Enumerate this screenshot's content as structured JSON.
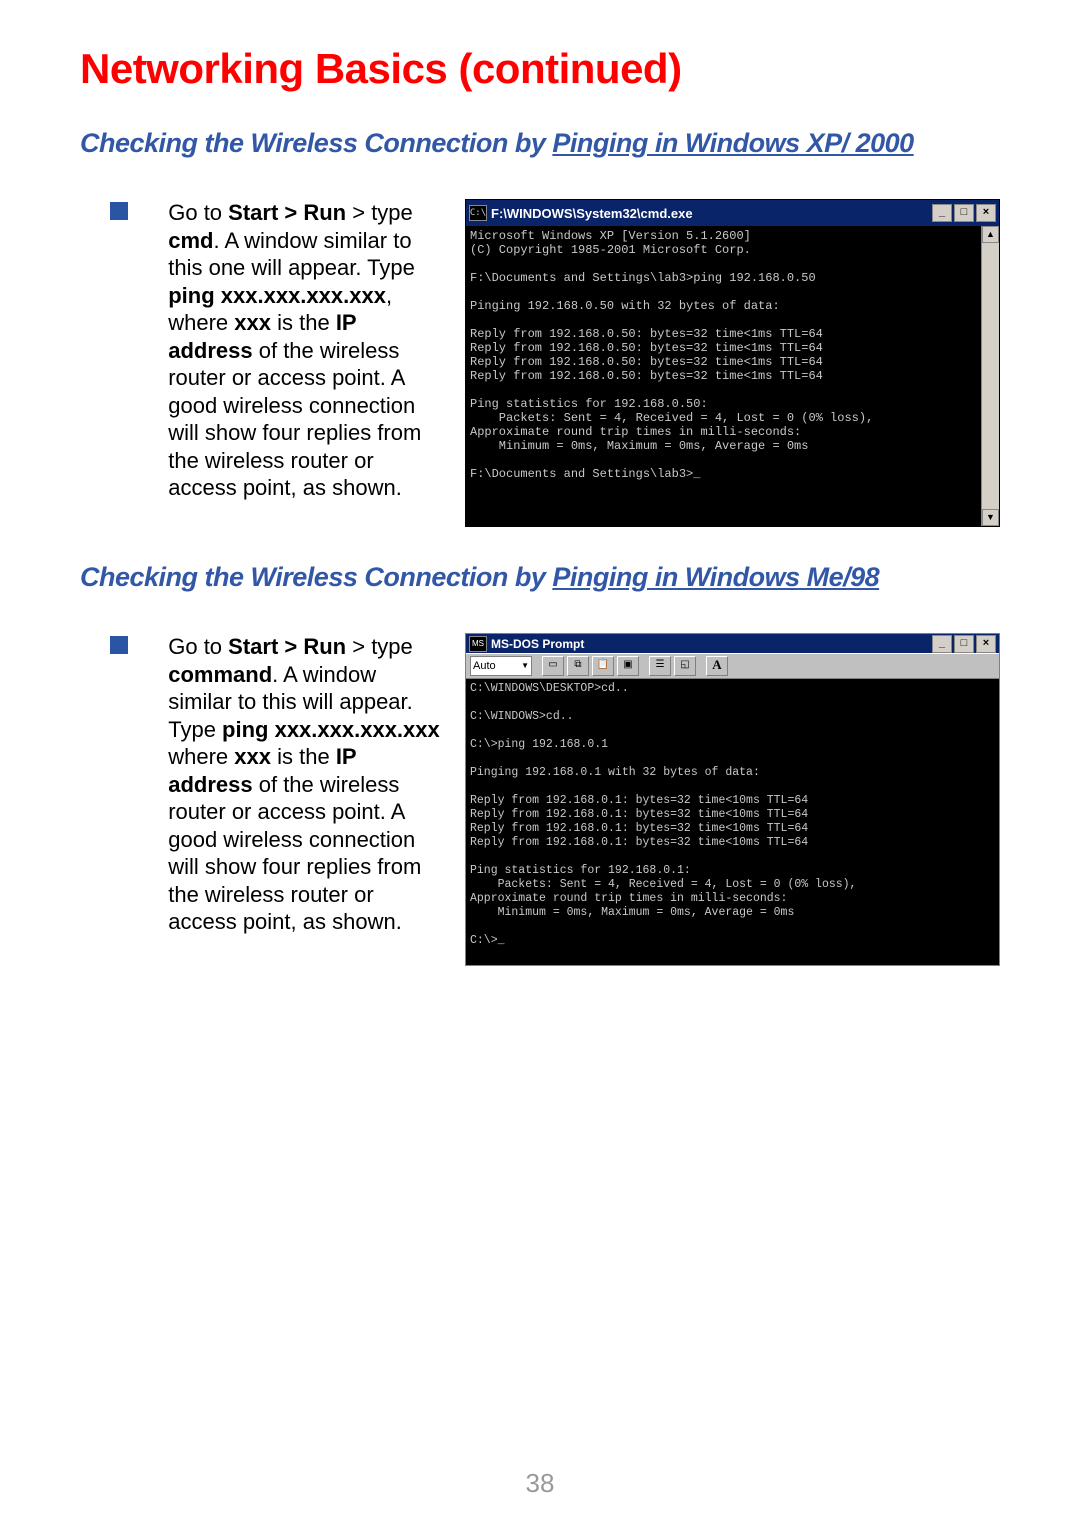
{
  "title": "Networking Basics (continued)",
  "section1": {
    "heading_pre": "Checking the Wireless Connection by ",
    "heading_ul": "Pinging in Windows XP/ 2000",
    "body_html": "Go to <b>Start &gt; Run</b> &gt; type <b>cmd</b>. A window similar to this one will appear. Type <b>ping xxx.xxx.xxx.xxx</b>, where <b>xxx</b> is the <b>IP address</b> of the wireless router or access point. A good wireless connection will show four replies from the wireless router or access point, as shown.",
    "cmd_title": "F:\\WINDOWS\\System32\\cmd.exe",
    "cmd_icon_text": "C:\\",
    "cmd_output": "Microsoft Windows XP [Version 5.1.2600]\n(C) Copyright 1985-2001 Microsoft Corp.\n\nF:\\Documents and Settings\\lab3>ping 192.168.0.50\n\nPinging 192.168.0.50 with 32 bytes of data:\n\nReply from 192.168.0.50: bytes=32 time<1ms TTL=64\nReply from 192.168.0.50: bytes=32 time<1ms TTL=64\nReply from 192.168.0.50: bytes=32 time<1ms TTL=64\nReply from 192.168.0.50: bytes=32 time<1ms TTL=64\n\nPing statistics for 192.168.0.50:\n    Packets: Sent = 4, Received = 4, Lost = 0 (0% loss),\nApproximate round trip times in milli-seconds:\n    Minimum = 0ms, Maximum = 0ms, Average = 0ms\n\nF:\\Documents and Settings\\lab3>_\n\n\n\n\n"
  },
  "section2": {
    "heading_pre": "Checking the Wireless Connection by ",
    "heading_ul": "Pinging in Windows Me/98",
    "body_html": "Go to <b>Start &gt; Run</b> &gt; type <b>command</b>. A window similar to this will appear. Type <b>ping xxx.xxx.xxx.xxx</b> where <b>xxx</b> is the <b>IP address</b> of the wireless router or access point. A good wireless connection will show four replies from the wireless router or access point, as shown.",
    "dos_title": "MS-DOS Prompt",
    "dos_auto": "Auto",
    "dos_output": "C:\\WINDOWS\\DESKTOP>cd..\n\nC:\\WINDOWS>cd..\n\nC:\\>ping 192.168.0.1\n\nPinging 192.168.0.1 with 32 bytes of data:\n\nReply from 192.168.0.1: bytes=32 time<10ms TTL=64\nReply from 192.168.0.1: bytes=32 time<10ms TTL=64\nReply from 192.168.0.1: bytes=32 time<10ms TTL=64\nReply from 192.168.0.1: bytes=32 time<10ms TTL=64\n\nPing statistics for 192.168.0.1:\n    Packets: Sent = 4, Received = 4, Lost = 0 (0% loss),\nApproximate round trip times in milli-seconds:\n    Minimum = 0ms, Maximum = 0ms, Average = 0ms\n\nC:\\>_\n\n"
  },
  "winbuttons": {
    "min": "_",
    "max": "□",
    "close": "×"
  },
  "scroll": {
    "up": "▲",
    "down": "▼"
  },
  "dos_icons": {
    "A": "A"
  },
  "pagenum": "38"
}
